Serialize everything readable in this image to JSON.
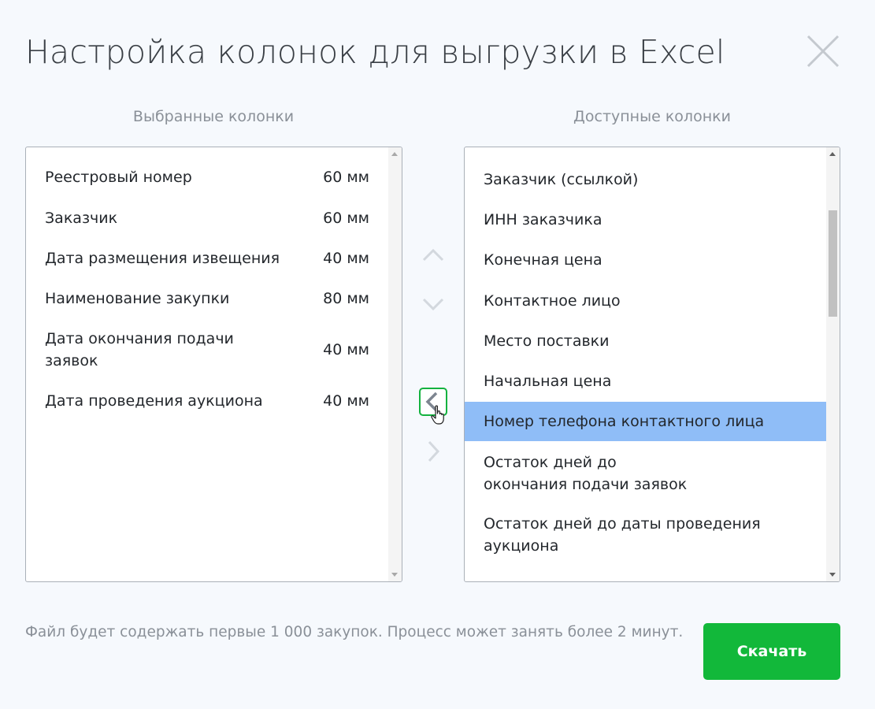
{
  "dialog": {
    "title": "Настройка колонок для выгрузки в Excel"
  },
  "selected_columns": {
    "heading": "Выбранные колонки",
    "items": [
      {
        "name": "Реестровый номер",
        "width": "60 мм"
      },
      {
        "name": "Заказчик",
        "width": "60 мм"
      },
      {
        "name": "Дата размещения извещения",
        "width": "40 мм"
      },
      {
        "name": "Наименование закупки",
        "width": "80 мм"
      },
      {
        "name": "Дата окончания подачи заявок",
        "width": "40 мм"
      },
      {
        "name": "Дата проведения аукциона",
        "width": "40 мм"
      }
    ]
  },
  "available_columns": {
    "heading": "Доступные колонки",
    "items": [
      {
        "name": "Заказчик (ссылкой)"
      },
      {
        "name": "ИНН заказчика"
      },
      {
        "name": "Конечная цена"
      },
      {
        "name": "Контактное лицо"
      },
      {
        "name": "Место поставки"
      },
      {
        "name": "Начальная цена"
      },
      {
        "name": "Номер телефона контактного лица",
        "selected": true
      },
      {
        "name": "Остаток дней до окончания подачи заявок"
      },
      {
        "name": "Остаток дней до даты проведения аукциона"
      }
    ]
  },
  "footer": {
    "note": "Файл будет содержать первые 1 000 закупок. Процесс может занять более 2 минут.",
    "download_label": "Скачать"
  },
  "colors": {
    "accent_green": "#12b83a",
    "selection_blue": "#8fbdf7",
    "muted_text": "#8a9098",
    "background": "#f6f9fd"
  },
  "icons": {
    "close": "close-icon",
    "move_up": "chevron-up-icon",
    "move_down": "chevron-down-icon",
    "move_left": "chevron-left-icon",
    "move_right": "chevron-right-icon",
    "cursor": "hand-pointer-icon"
  }
}
